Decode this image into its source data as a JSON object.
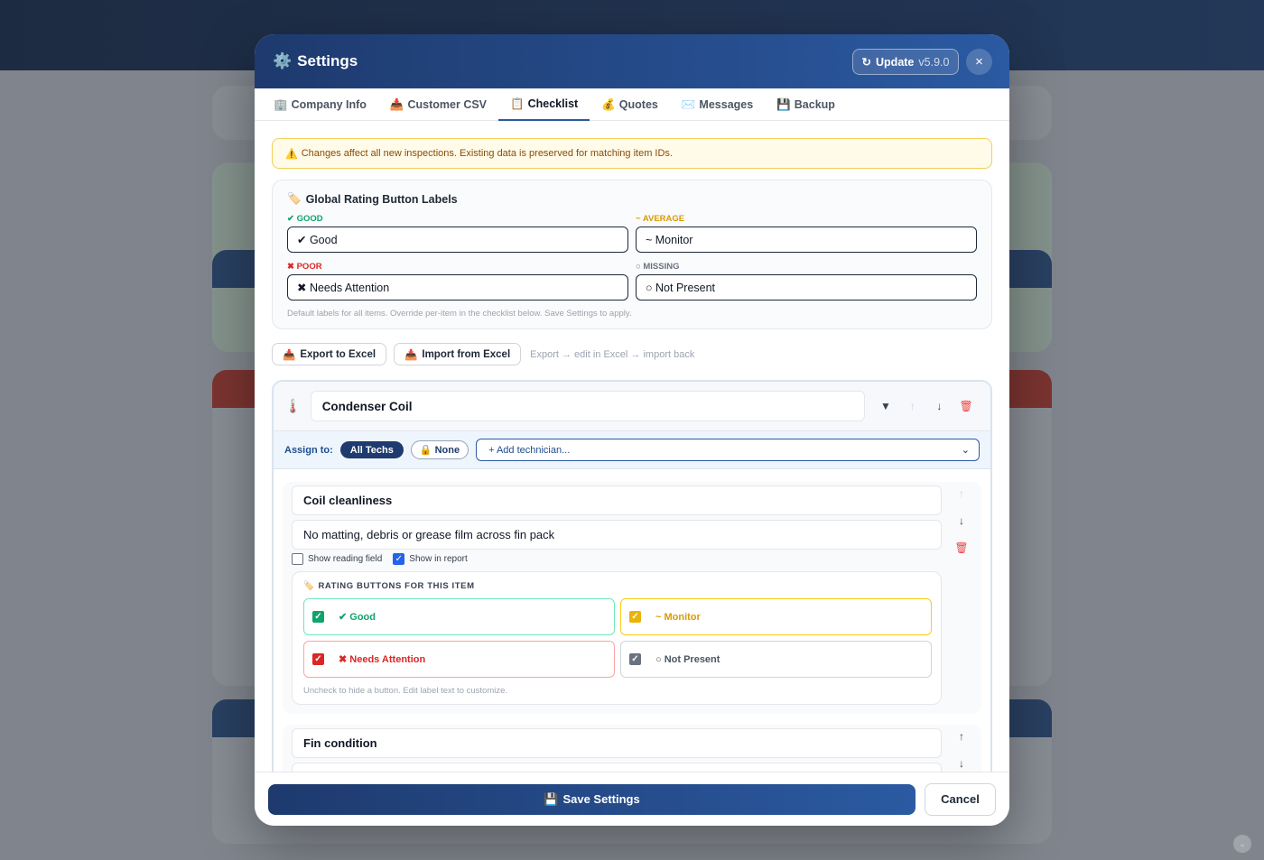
{
  "modal": {
    "title": "Settings",
    "title_icon": "gear-icon",
    "update_label": "Update",
    "update_version": "v5.9.0",
    "close_label": "×"
  },
  "tabs": [
    {
      "icon": "🏢",
      "label": "Company Info"
    },
    {
      "icon": "📥",
      "label": "Customer CSV"
    },
    {
      "icon": "📋",
      "label": "Checklist",
      "active": true
    },
    {
      "icon": "💰",
      "label": "Quotes"
    },
    {
      "icon": "✉️",
      "label": "Messages"
    },
    {
      "icon": "💾",
      "label": "Backup"
    }
  ],
  "warning": "Changes affect all new inspections. Existing data is preserved for matching item IDs.",
  "global_labels": {
    "title": "Global Rating Button Labels",
    "good_caption": "✔ GOOD",
    "good_value": "✔ Good",
    "average_caption": "~ AVERAGE",
    "average_value": "~ Monitor",
    "poor_caption": "✖ POOR",
    "poor_value": "✖ Needs Attention",
    "missing_caption": "○ MISSING",
    "missing_value": "○ Not Present",
    "hint": "Default labels for all items. Override per-item in the checklist below. Save Settings to apply."
  },
  "excel": {
    "export_label": "Export to Excel",
    "import_label": "Import from Excel",
    "hint": "Export → edit in Excel → import back"
  },
  "section": {
    "name": "Condenser Coil",
    "assign_label": "Assign to:",
    "all_techs": "All Techs",
    "none": "None",
    "add_tech": "+ Add technician..."
  },
  "items": [
    {
      "title": "Coil cleanliness",
      "description": "No matting, debris or grease film across fin pack",
      "show_reading_label": "Show reading field",
      "show_reading": false,
      "show_report_label": "Show in report",
      "show_report": true,
      "rating_title": "RATING BUTTONS FOR THIS ITEM",
      "buttons": {
        "good": "✔ Good",
        "average": "~ Monitor",
        "poor": "✖ Needs Attention",
        "missing": "○ Not Present"
      },
      "rating_hint": "Uncheck to hide a button. Edit label text to customize."
    },
    {
      "title": "Fin condition"
    }
  ],
  "footer": {
    "save_label": "Save Settings",
    "cancel_label": "Cancel"
  },
  "colors": {
    "header_start": "#1e3a6e",
    "header_end": "#2b5aa2",
    "good": "#10a36b",
    "average": "#d99a06",
    "poor": "#dc2626",
    "missing": "#6b7280"
  }
}
